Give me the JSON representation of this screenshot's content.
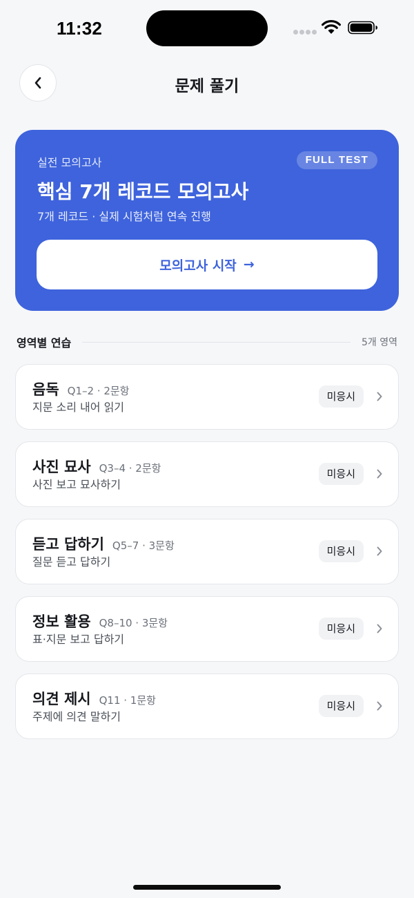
{
  "status_bar": {
    "time": "11:32"
  },
  "header": {
    "title": "문제 풀기"
  },
  "hero": {
    "eyebrow": "실전 모의고사",
    "badge": "FULL TEST",
    "title": "핵심 7개 레코드 모의고사",
    "subtitle": "7개 레코드 · 실제 시험처럼 연속 진행",
    "button_label": "모의고사 시작",
    "button_arrow": "→"
  },
  "section": {
    "title": "영역별 연습",
    "count": "5개 영역"
  },
  "practice_items": [
    {
      "title": "음독",
      "meta": "Q1–2 · 2문항",
      "desc": "지문 소리 내어 읽기",
      "status": "미응시"
    },
    {
      "title": "사진 묘사",
      "meta": "Q3–4 · 2문항",
      "desc": "사진 보고 묘사하기",
      "status": "미응시"
    },
    {
      "title": "듣고 답하기",
      "meta": "Q5–7 · 3문항",
      "desc": "질문 듣고 답하기",
      "status": "미응시"
    },
    {
      "title": "정보 활용",
      "meta": "Q8–10 · 3문항",
      "desc": "표·지문 보고 답하기",
      "status": "미응시"
    },
    {
      "title": "의견 제시",
      "meta": "Q11 · 1문항",
      "desc": "주제에 의견 말하기",
      "status": "미응시"
    }
  ],
  "colors": {
    "accent": "#3e63dc",
    "background": "#f6f7f9",
    "card": "#ffffff",
    "badge_bg": "#f1f2f4"
  },
  "icons": [
    "back-chevron-icon",
    "wifi-icon",
    "battery-icon",
    "signal-icon",
    "chevron-right-icon"
  ]
}
